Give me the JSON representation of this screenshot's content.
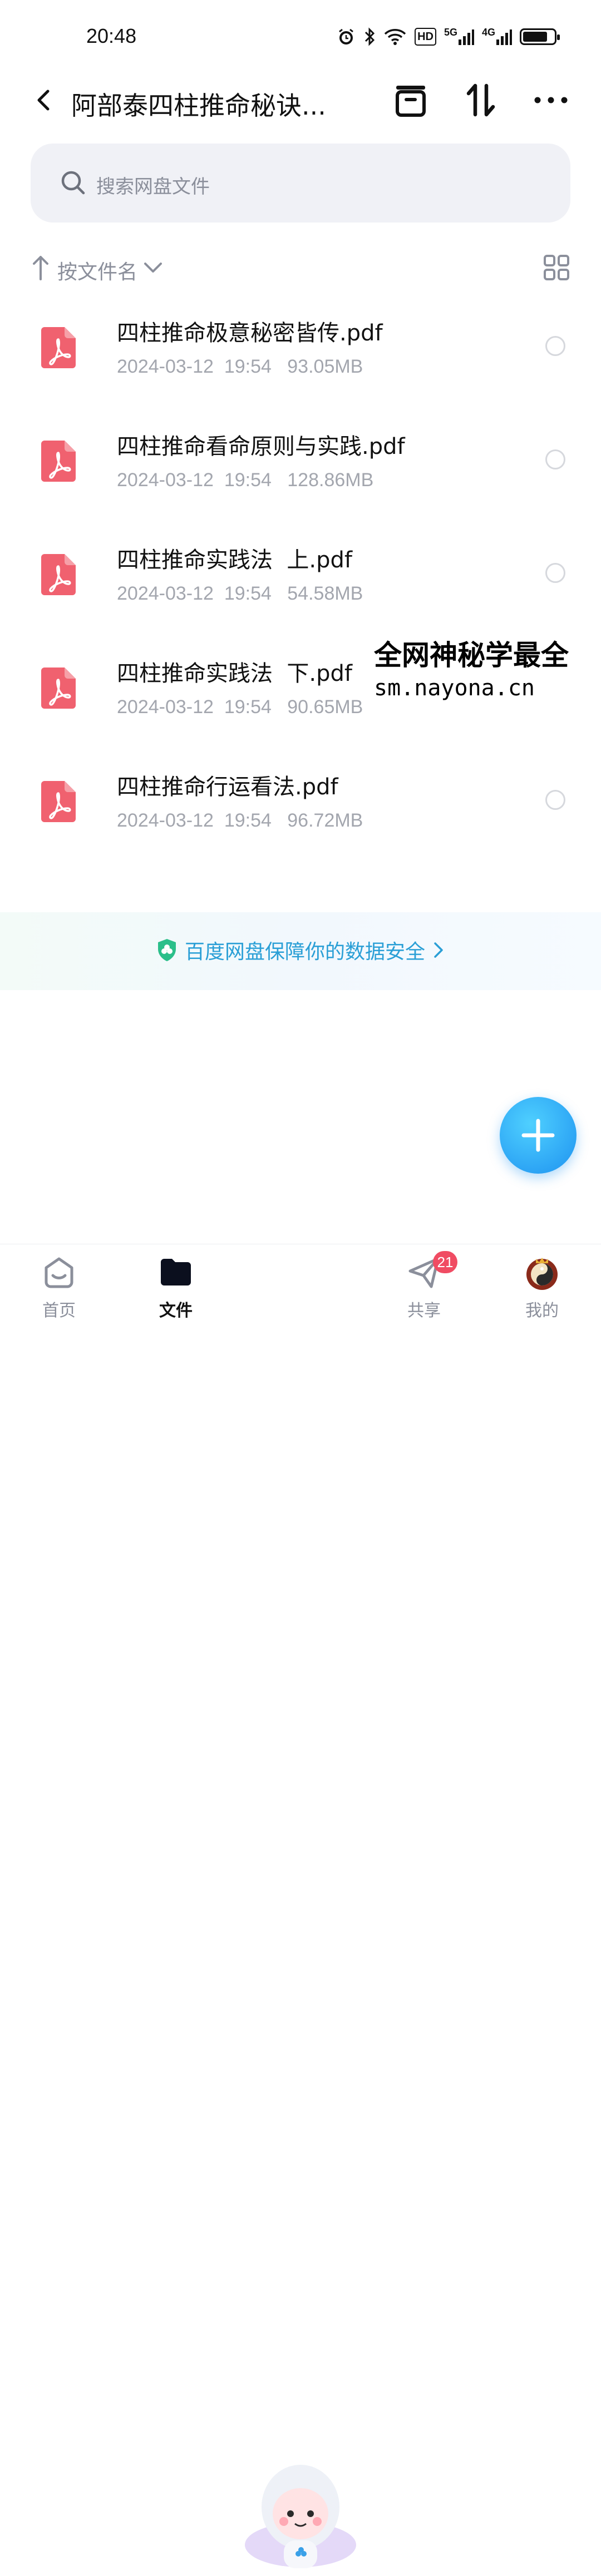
{
  "status_bar": {
    "time": "20:48",
    "icons": [
      "alarm-icon",
      "bluetooth-icon",
      "wifi-icon",
      "hd-icon",
      "signal-5g-icon",
      "signal-4g-icon",
      "battery-icon"
    ],
    "hd_label": "HD",
    "net1": "5G",
    "net2": "4G",
    "battery_level": 0.8
  },
  "header": {
    "title": "阿部泰四柱推命秘诀..."
  },
  "search": {
    "placeholder": "搜索网盘文件"
  },
  "sort": {
    "label": "按文件名"
  },
  "files": [
    {
      "name": "四柱推命极意秘密皆传.pdf",
      "date": "2024-03-12",
      "time": "19:54",
      "size": "93.05MB"
    },
    {
      "name": "四柱推命看命原则与实践.pdf",
      "date": "2024-03-12",
      "time": "19:54",
      "size": "128.86MB"
    },
    {
      "name": "四柱推命实践法  上.pdf",
      "date": "2024-03-12",
      "time": "19:54",
      "size": "54.58MB"
    },
    {
      "name": "四柱推命实践法  下.pdf",
      "date": "2024-03-12",
      "time": "19:54",
      "size": "90.65MB"
    },
    {
      "name": "四柱推命行运看法.pdf",
      "date": "2024-03-12",
      "time": "19:54",
      "size": "96.72MB"
    }
  ],
  "watermark": {
    "line1": "全网神秘学最全",
    "line2": "sm.nayona.cn"
  },
  "security_banner": {
    "text": "百度网盘保障你的数据安全"
  },
  "nav": {
    "home": "首页",
    "files": "文件",
    "share": "共享",
    "share_badge": "21",
    "me": "我的"
  },
  "colors": {
    "accent": "#1e92f0",
    "pdf_red": "#f0616f",
    "badge": "#f04c63",
    "secure_text": "#2a9fd6"
  }
}
